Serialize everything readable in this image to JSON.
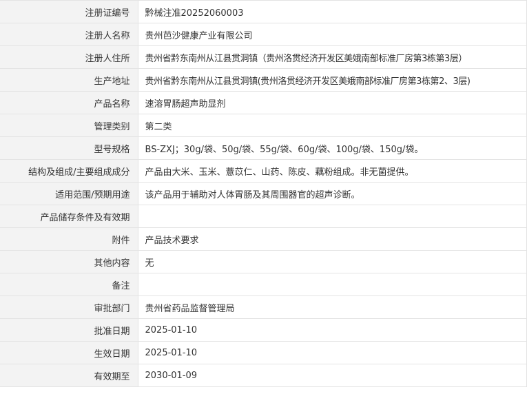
{
  "rows": [
    {
      "label": "注册证编号",
      "value": "黔械注准20252060003"
    },
    {
      "label": "注册人名称",
      "value": "贵州芭沙健康产业有限公司"
    },
    {
      "label": "注册人住所",
      "value": "贵州省黔东南州从江县贯洞镇（贵州洛贯经济开发区美娥南部标准厂房第3栋第3层）"
    },
    {
      "label": "生产地址",
      "value": "贵州省黔东南州从江县贯洞镇(贵州洛贯经济开发区美娥南部标准厂房第3栋第2、3层)"
    },
    {
      "label": "产品名称",
      "value": "速溶胃肠超声助显剂"
    },
    {
      "label": "管理类别",
      "value": "第二类"
    },
    {
      "label": "型号规格",
      "value": "BS-ZXJ；30g/袋、50g/袋、55g/袋、60g/袋、100g/袋、150g/袋。"
    },
    {
      "label": "结构及组成/主要组成成分",
      "value": "产品由大米、玉米、薏苡仁、山药、陈皮、藕粉组成。非无菌提供。"
    },
    {
      "label": "适用范围/预期用途",
      "value": "该产品用于辅助对人体胃肠及其周围器官的超声诊断。"
    },
    {
      "label": "产品储存条件及有效期",
      "value": ""
    },
    {
      "label": "附件",
      "value": "产品技术要求"
    },
    {
      "label": "其他内容",
      "value": "无"
    },
    {
      "label": "备注",
      "value": ""
    },
    {
      "label": "审批部门",
      "value": "贵州省药品监督管理局"
    },
    {
      "label": "批准日期",
      "value": "2025-01-10"
    },
    {
      "label": "生效日期",
      "value": "2025-01-10"
    },
    {
      "label": "有效期至",
      "value": "2030-01-09"
    }
  ]
}
